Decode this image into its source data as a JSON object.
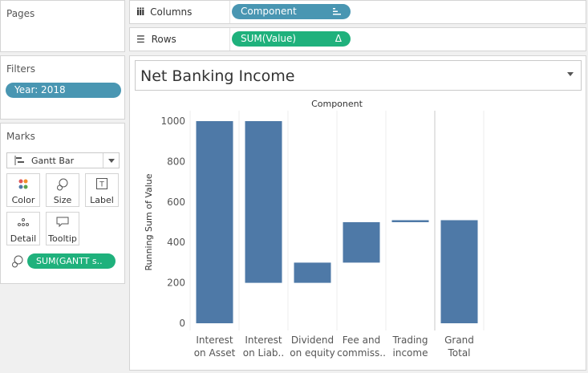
{
  "pages": {
    "title": "Pages"
  },
  "filters": {
    "title": "Filters",
    "pills": [
      "Year: 2018"
    ]
  },
  "marks": {
    "title": "Marks",
    "mark_type": "Gantt Bar",
    "cards": [
      "Color",
      "Size",
      "Label",
      "Detail",
      "Tooltip"
    ],
    "field_pill": "SUM(GANTT s.."
  },
  "columns": {
    "label": "Columns",
    "pill": "Component"
  },
  "rows": {
    "label": "Rows",
    "pill": "SUM(Value)",
    "pill_icon": "Δ"
  },
  "view": {
    "title": "Net Banking Income"
  },
  "colors": {
    "bar": "#4e79a7",
    "pill_blue": "#4996b2",
    "pill_green": "#1fb17c"
  },
  "chart_data": {
    "type": "bar",
    "subtype": "gantt-waterfall",
    "header": "Component",
    "ylabel": "Running Sum of Value",
    "ylim": [
      0,
      1000
    ],
    "yticks": [
      0,
      200,
      400,
      600,
      800,
      1000
    ],
    "categories": [
      [
        "Interest",
        "on Asset"
      ],
      [
        "Interest",
        "on Liab.."
      ],
      [
        "Dividend",
        "on equity"
      ],
      [
        "Fee and",
        "commiss.."
      ],
      [
        "Trading",
        "income"
      ],
      [
        "Grand",
        "Total"
      ]
    ],
    "bars": [
      {
        "from": 0,
        "to": 1000
      },
      {
        "from": 200,
        "to": 1000
      },
      {
        "from": 200,
        "to": 300
      },
      {
        "from": 300,
        "to": 500
      },
      {
        "from": 500,
        "to": 510
      },
      {
        "from": 0,
        "to": 510
      }
    ]
  }
}
